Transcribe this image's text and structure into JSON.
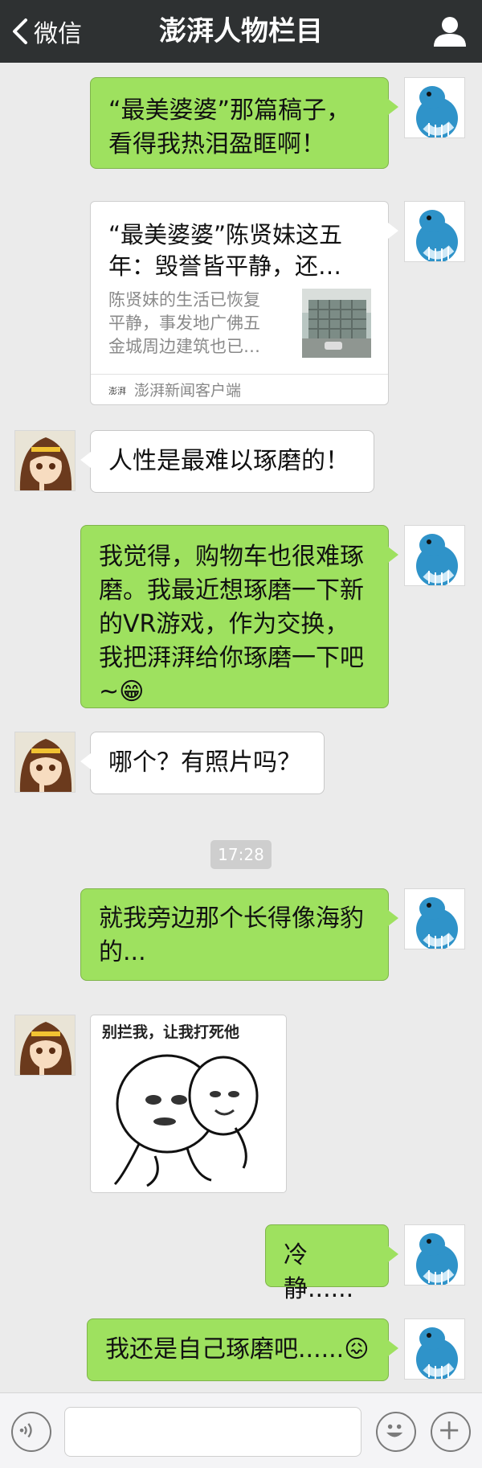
{
  "header": {
    "back_label": "微信",
    "title": "澎湃人物栏目"
  },
  "messages": [
    {
      "side": "right",
      "type": "text",
      "text": "“最美婆婆”那篇稿子，\n看得我热泪盈眶啊！"
    },
    {
      "side": "right",
      "type": "link_card",
      "title": "“最美婆婆”陈贤妹这五年：毁誉皆平静，还…",
      "description": "陈贤妹的生活已恢复平静，事发地广佛五金城周边建筑也已…",
      "source_icon": "澎湃",
      "source": "澎湃新闻客户端"
    },
    {
      "side": "left",
      "type": "text",
      "text": "人性是最难以琢磨的！"
    },
    {
      "side": "right",
      "type": "text",
      "text": "我觉得，购物车也很难琢\n磨。我最近想琢磨一下新\n的VR游戏，作为交换，\n我把湃湃给你琢磨一下吧\n~😁"
    },
    {
      "side": "left",
      "type": "text",
      "text": "哪个？有照片吗？"
    },
    {
      "side": "right",
      "type": "text",
      "text": "就我旁边那个长得像海豹\n的..."
    },
    {
      "side": "left",
      "type": "image",
      "caption": "别拦我，让我打死他"
    },
    {
      "side": "right",
      "type": "text",
      "text": "冷静......"
    },
    {
      "side": "right",
      "type": "text",
      "text": "我还是自己琢磨吧......😖"
    }
  ],
  "timestamp": "17:28",
  "input_bar": {
    "voice_icon": "voice-icon",
    "emoji_icon": "emoji-icon",
    "plus_icon": "plus-icon",
    "placeholder": ""
  },
  "colors": {
    "header_bg": "#2e3132",
    "chat_bg": "#ebebeb",
    "sent_bubble": "#9ee15f",
    "received_bubble": "#ffffff"
  }
}
